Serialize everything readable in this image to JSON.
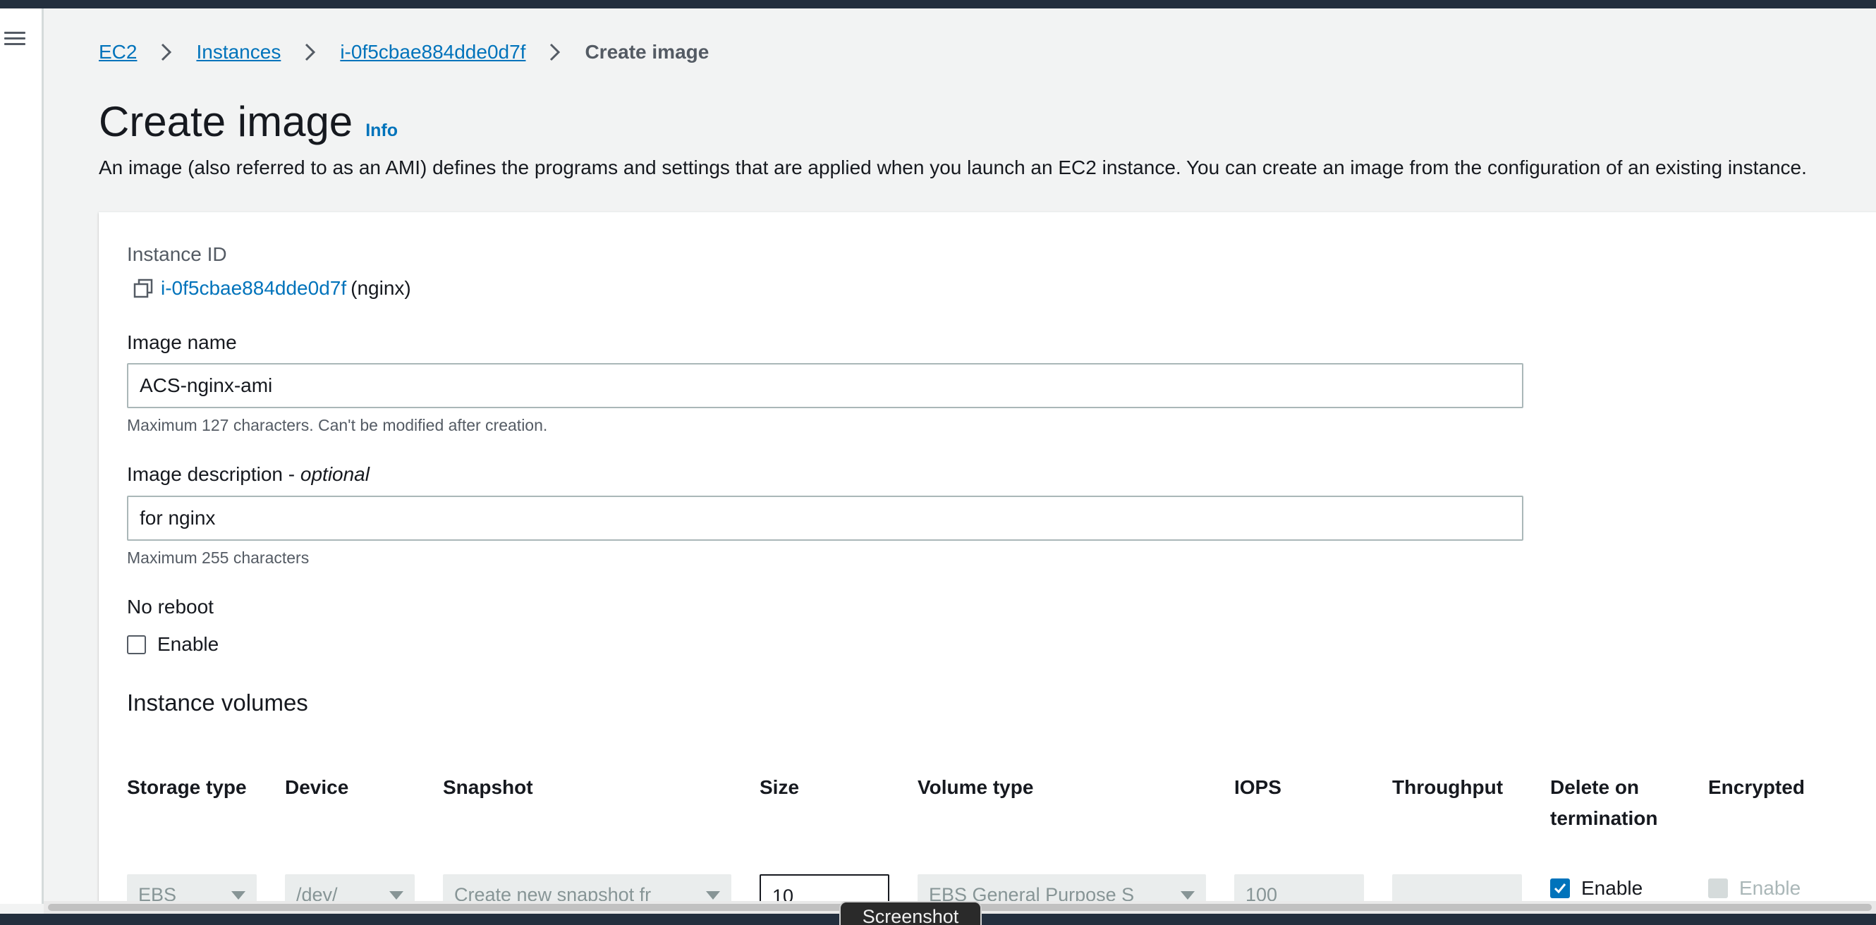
{
  "breadcrumb": {
    "items": [
      "EC2",
      "Instances",
      "i-0f5cbae884dde0d7f"
    ],
    "current": "Create image"
  },
  "page": {
    "title": "Create image",
    "info_link": "Info",
    "description": "An image (also referred to as an AMI) defines the programs and settings that are applied when you launch an EC2 instance. You can create an image from the configuration of an existing instance."
  },
  "form": {
    "instance_id_label": "Instance ID",
    "instance_id": "i-0f5cbae884dde0d7f",
    "instance_name": "(nginx)",
    "image_name_label": "Image name",
    "image_name_value": "ACS-nginx-ami",
    "image_name_hint": "Maximum 127 characters. Can't be modified after creation.",
    "image_desc_label": "Image description - ",
    "image_desc_optional": "optional",
    "image_desc_value": "for nginx",
    "image_desc_hint": "Maximum 255 characters",
    "no_reboot_label": "No reboot",
    "no_reboot_enable": "Enable",
    "no_reboot_checked": false
  },
  "volumes": {
    "title": "Instance volumes",
    "columns": [
      "Storage type",
      "Device",
      "Snapshot",
      "Size",
      "Volume type",
      "IOPS",
      "Throughput",
      "Delete on termination",
      "Encrypted"
    ],
    "row": {
      "storage_type": "EBS",
      "device": "/dev/",
      "snapshot": "Create new snapshot fr",
      "size": "10",
      "volume_type": "EBS General Purpose S",
      "iops": "100",
      "throughput": "",
      "delete_on_termination_label": "Enable",
      "delete_on_termination_checked": true,
      "encrypted_label": "Enable",
      "encrypted_checked": false
    }
  },
  "overlay": {
    "tooltip": "Screenshot"
  },
  "colors": {
    "link": "#0073bb",
    "nav_dark": "#232f3e",
    "background": "#f2f3f3"
  }
}
